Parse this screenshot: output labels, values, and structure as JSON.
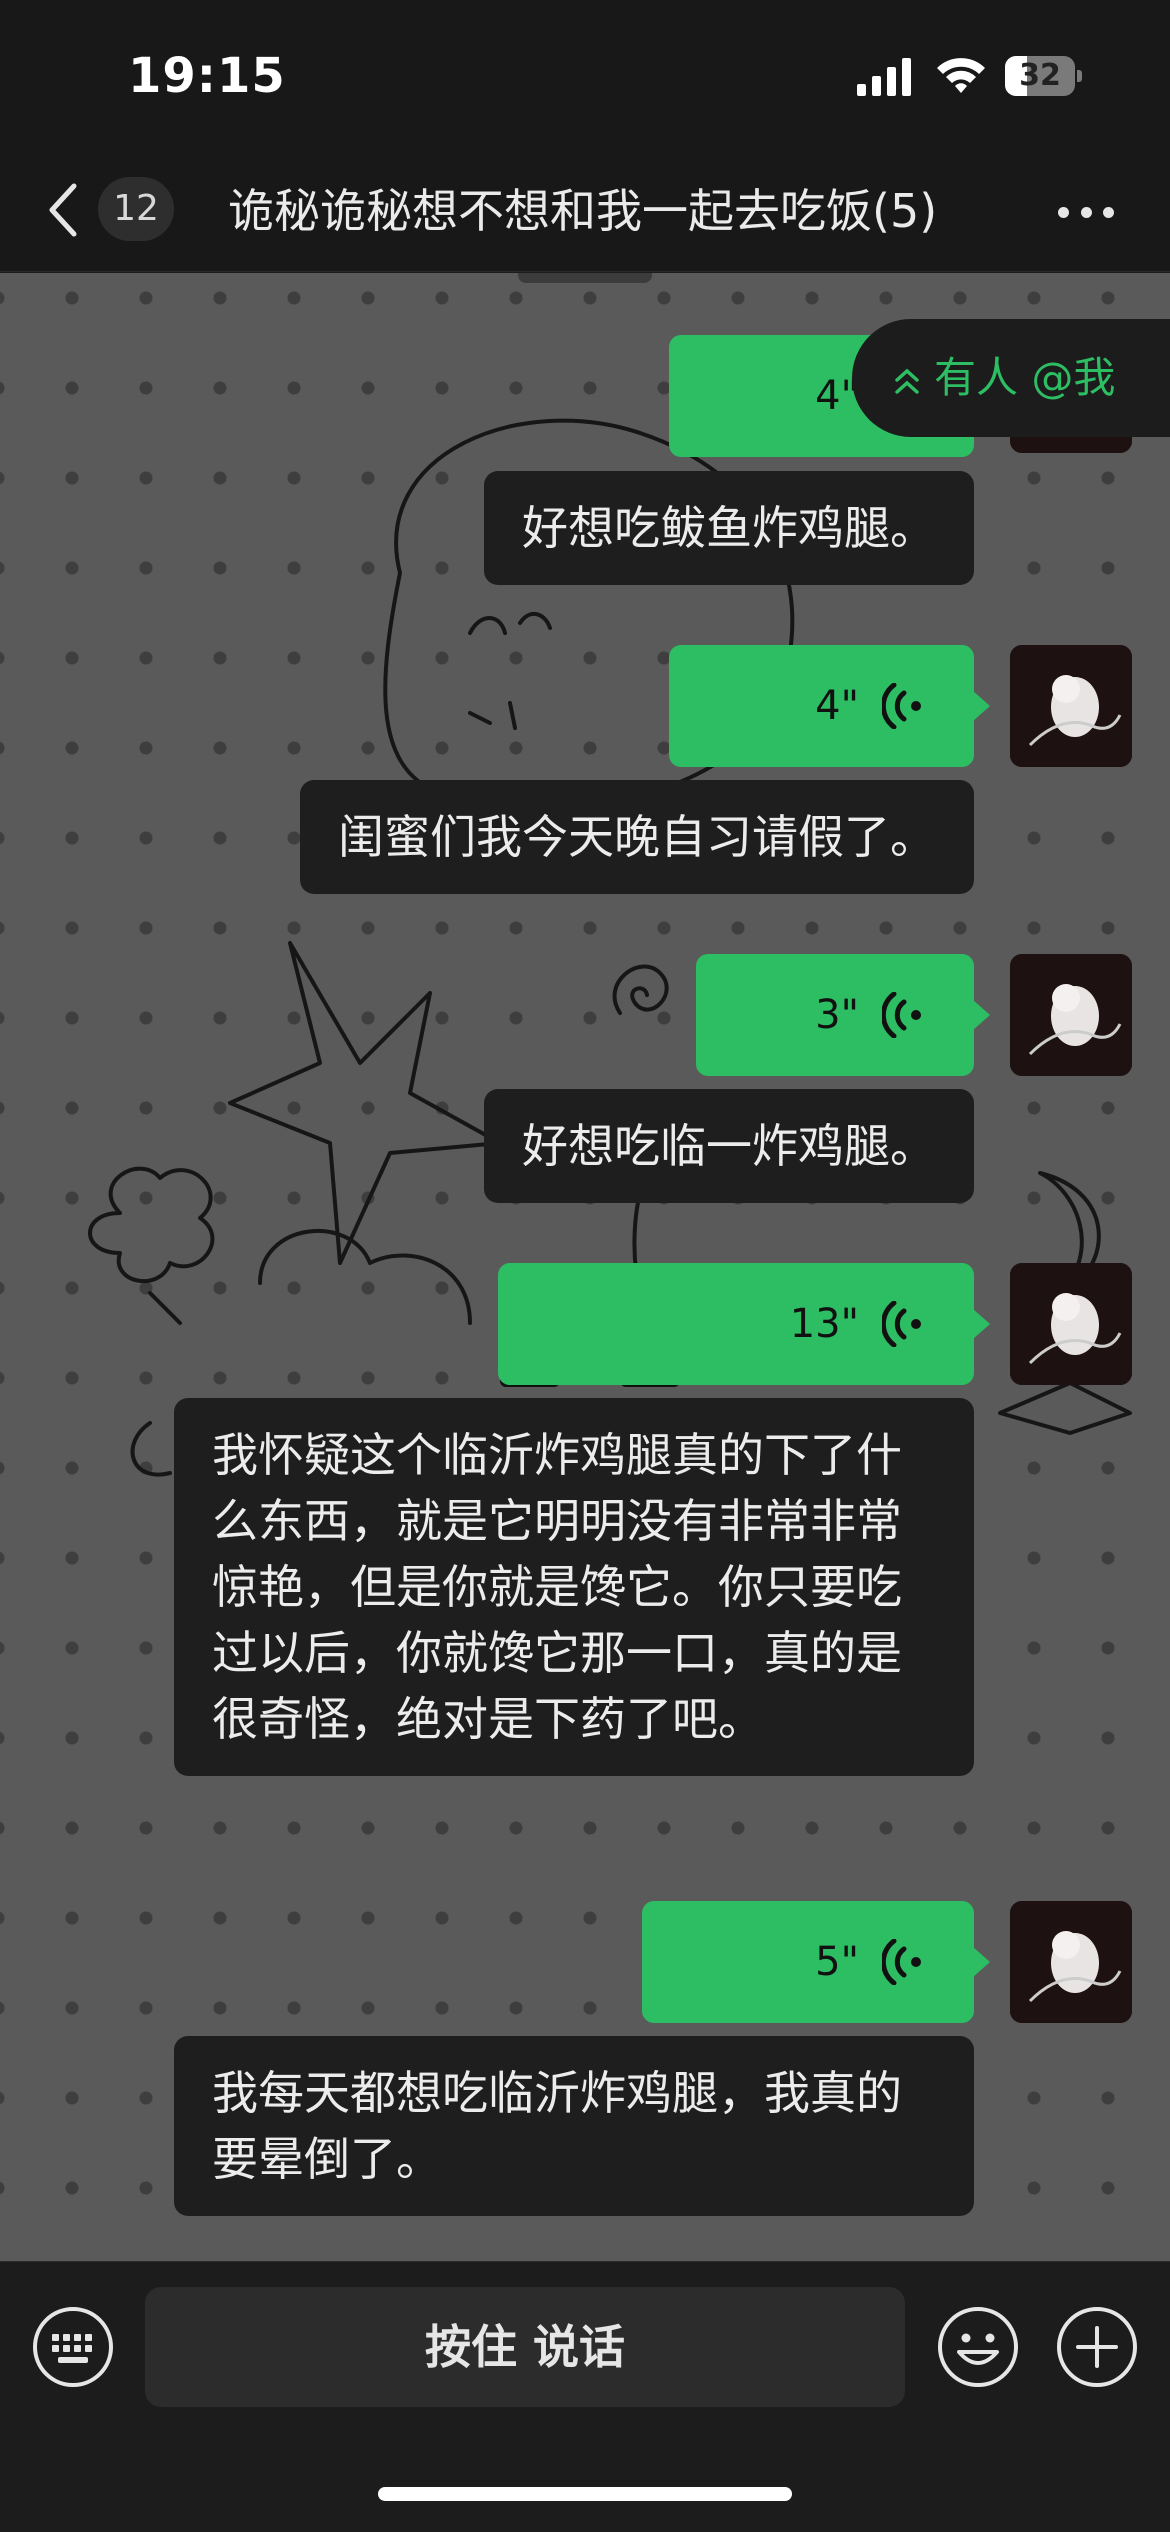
{
  "status_bar": {
    "time": "19:15",
    "battery": "32",
    "battery_level": 0.32
  },
  "nav": {
    "back_icon": "chevron-left-icon",
    "unread_count": "12",
    "title": "诡秘诡秘想不想和我一起去吃饭(5)",
    "more_icon": "ellipsis-icon"
  },
  "mention_banner": {
    "label": "有人 @我",
    "icon": "double-chevron-up-icon"
  },
  "messages": [
    {
      "duration": "4\"",
      "transcript": "好想吃鲅鱼炸鸡腿。"
    },
    {
      "duration": "4\"",
      "transcript": "闺蜜们我今天晚自习请假了。"
    },
    {
      "duration": "3\"",
      "transcript": "好想吃临一炸鸡腿。"
    },
    {
      "duration": "13\"",
      "transcript": "我怀疑这个临沂炸鸡腿真的下了什么东西，就是它明明没有非常非常惊艳，但是你就是馋它。你只要吃过以后，你就馋它那一口，真的是很奇怪，绝对是下药了吧。"
    },
    {
      "duration": "5\"",
      "transcript": "我每天都想吃临沂炸鸡腿，我真的要晕倒了。"
    }
  ],
  "input_bar": {
    "keyboard_icon": "keyboard-icon",
    "hold_to_talk": "按住 说话",
    "emoji_icon": "emoji-icon",
    "plus_icon": "plus-icon"
  },
  "colors": {
    "accent_green": "#2dbd63",
    "bubble_dark": "#1e1e1e",
    "bar_bg": "#1c1c1c"
  }
}
